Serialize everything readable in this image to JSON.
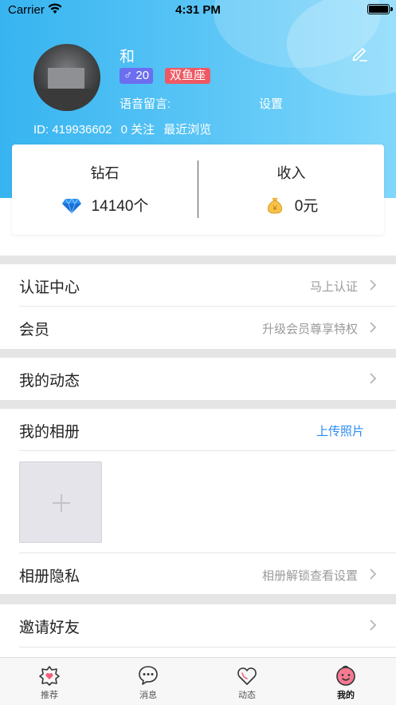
{
  "status_bar": {
    "carrier": "Carrier",
    "time": "4:31 PM"
  },
  "profile": {
    "nickname": "和",
    "gender_age": "♂ 20",
    "zodiac": "双鱼座",
    "voice_label": "语音留言:",
    "voice_setting": "设置",
    "id_text": "ID:  419936602",
    "follow_text": "0 关注",
    "recent_text": "最近浏览"
  },
  "wallet": {
    "diamond_title": "钻石",
    "diamond_value": "14140个",
    "income_title": "收入",
    "income_value": "0元"
  },
  "menu": {
    "verify": {
      "label": "认证中心",
      "value": "马上认证"
    },
    "vip": {
      "label": "会员",
      "value": "升级会员尊享特权"
    },
    "moments": {
      "label": "我的动态"
    },
    "album": {
      "label": "我的相册",
      "action": "上传照片"
    },
    "album_privacy": {
      "label": "相册隐私",
      "value": "相册解锁查看设置"
    },
    "invite": {
      "label": "邀请好友"
    }
  },
  "tabs": [
    {
      "label": "推荐",
      "icon": "recommend-icon"
    },
    {
      "label": "消息",
      "icon": "message-icon"
    },
    {
      "label": "动态",
      "icon": "moments-icon"
    },
    {
      "label": "我的",
      "icon": "mine-icon"
    }
  ],
  "colors": {
    "header_start": "#37b4f0",
    "header_end": "#7fd7fb",
    "gender_badge": "#6b6ef0",
    "zodiac_badge": "#ee5a64",
    "link_blue": "#2b8bf0"
  }
}
